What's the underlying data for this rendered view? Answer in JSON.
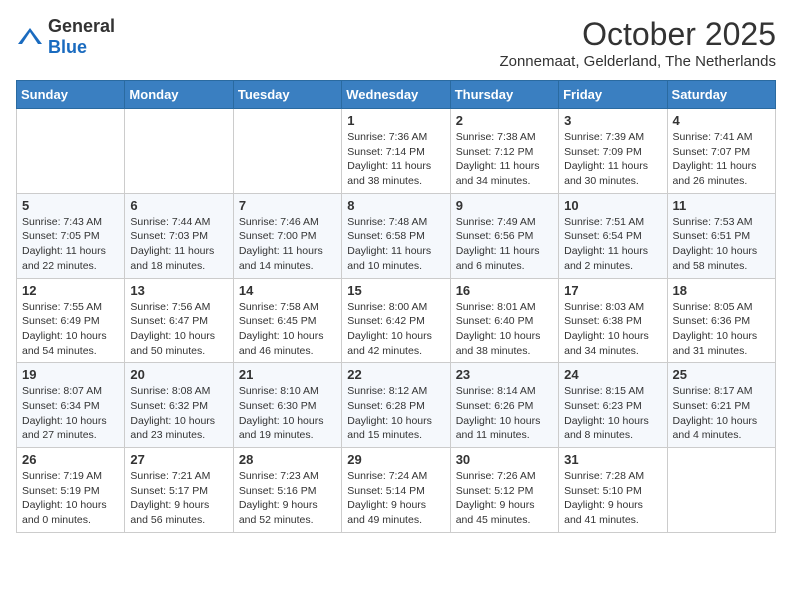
{
  "header": {
    "logo_general": "General",
    "logo_blue": "Blue",
    "month_title": "October 2025",
    "subtitle": "Zonnemaat, Gelderland, The Netherlands"
  },
  "days_of_week": [
    "Sunday",
    "Monday",
    "Tuesday",
    "Wednesday",
    "Thursday",
    "Friday",
    "Saturday"
  ],
  "weeks": [
    [
      {
        "day": "",
        "info": ""
      },
      {
        "day": "",
        "info": ""
      },
      {
        "day": "",
        "info": ""
      },
      {
        "day": "1",
        "info": "Sunrise: 7:36 AM\nSunset: 7:14 PM\nDaylight: 11 hours\nand 38 minutes."
      },
      {
        "day": "2",
        "info": "Sunrise: 7:38 AM\nSunset: 7:12 PM\nDaylight: 11 hours\nand 34 minutes."
      },
      {
        "day": "3",
        "info": "Sunrise: 7:39 AM\nSunset: 7:09 PM\nDaylight: 11 hours\nand 30 minutes."
      },
      {
        "day": "4",
        "info": "Sunrise: 7:41 AM\nSunset: 7:07 PM\nDaylight: 11 hours\nand 26 minutes."
      }
    ],
    [
      {
        "day": "5",
        "info": "Sunrise: 7:43 AM\nSunset: 7:05 PM\nDaylight: 11 hours\nand 22 minutes."
      },
      {
        "day": "6",
        "info": "Sunrise: 7:44 AM\nSunset: 7:03 PM\nDaylight: 11 hours\nand 18 minutes."
      },
      {
        "day": "7",
        "info": "Sunrise: 7:46 AM\nSunset: 7:00 PM\nDaylight: 11 hours\nand 14 minutes."
      },
      {
        "day": "8",
        "info": "Sunrise: 7:48 AM\nSunset: 6:58 PM\nDaylight: 11 hours\nand 10 minutes."
      },
      {
        "day": "9",
        "info": "Sunrise: 7:49 AM\nSunset: 6:56 PM\nDaylight: 11 hours\nand 6 minutes."
      },
      {
        "day": "10",
        "info": "Sunrise: 7:51 AM\nSunset: 6:54 PM\nDaylight: 11 hours\nand 2 minutes."
      },
      {
        "day": "11",
        "info": "Sunrise: 7:53 AM\nSunset: 6:51 PM\nDaylight: 10 hours\nand 58 minutes."
      }
    ],
    [
      {
        "day": "12",
        "info": "Sunrise: 7:55 AM\nSunset: 6:49 PM\nDaylight: 10 hours\nand 54 minutes."
      },
      {
        "day": "13",
        "info": "Sunrise: 7:56 AM\nSunset: 6:47 PM\nDaylight: 10 hours\nand 50 minutes."
      },
      {
        "day": "14",
        "info": "Sunrise: 7:58 AM\nSunset: 6:45 PM\nDaylight: 10 hours\nand 46 minutes."
      },
      {
        "day": "15",
        "info": "Sunrise: 8:00 AM\nSunset: 6:42 PM\nDaylight: 10 hours\nand 42 minutes."
      },
      {
        "day": "16",
        "info": "Sunrise: 8:01 AM\nSunset: 6:40 PM\nDaylight: 10 hours\nand 38 minutes."
      },
      {
        "day": "17",
        "info": "Sunrise: 8:03 AM\nSunset: 6:38 PM\nDaylight: 10 hours\nand 34 minutes."
      },
      {
        "day": "18",
        "info": "Sunrise: 8:05 AM\nSunset: 6:36 PM\nDaylight: 10 hours\nand 31 minutes."
      }
    ],
    [
      {
        "day": "19",
        "info": "Sunrise: 8:07 AM\nSunset: 6:34 PM\nDaylight: 10 hours\nand 27 minutes."
      },
      {
        "day": "20",
        "info": "Sunrise: 8:08 AM\nSunset: 6:32 PM\nDaylight: 10 hours\nand 23 minutes."
      },
      {
        "day": "21",
        "info": "Sunrise: 8:10 AM\nSunset: 6:30 PM\nDaylight: 10 hours\nand 19 minutes."
      },
      {
        "day": "22",
        "info": "Sunrise: 8:12 AM\nSunset: 6:28 PM\nDaylight: 10 hours\nand 15 minutes."
      },
      {
        "day": "23",
        "info": "Sunrise: 8:14 AM\nSunset: 6:26 PM\nDaylight: 10 hours\nand 11 minutes."
      },
      {
        "day": "24",
        "info": "Sunrise: 8:15 AM\nSunset: 6:23 PM\nDaylight: 10 hours\nand 8 minutes."
      },
      {
        "day": "25",
        "info": "Sunrise: 8:17 AM\nSunset: 6:21 PM\nDaylight: 10 hours\nand 4 minutes."
      }
    ],
    [
      {
        "day": "26",
        "info": "Sunrise: 7:19 AM\nSunset: 5:19 PM\nDaylight: 10 hours\nand 0 minutes."
      },
      {
        "day": "27",
        "info": "Sunrise: 7:21 AM\nSunset: 5:17 PM\nDaylight: 9 hours\nand 56 minutes."
      },
      {
        "day": "28",
        "info": "Sunrise: 7:23 AM\nSunset: 5:16 PM\nDaylight: 9 hours\nand 52 minutes."
      },
      {
        "day": "29",
        "info": "Sunrise: 7:24 AM\nSunset: 5:14 PM\nDaylight: 9 hours\nand 49 minutes."
      },
      {
        "day": "30",
        "info": "Sunrise: 7:26 AM\nSunset: 5:12 PM\nDaylight: 9 hours\nand 45 minutes."
      },
      {
        "day": "31",
        "info": "Sunrise: 7:28 AM\nSunset: 5:10 PM\nDaylight: 9 hours\nand 41 minutes."
      },
      {
        "day": "",
        "info": ""
      }
    ]
  ]
}
